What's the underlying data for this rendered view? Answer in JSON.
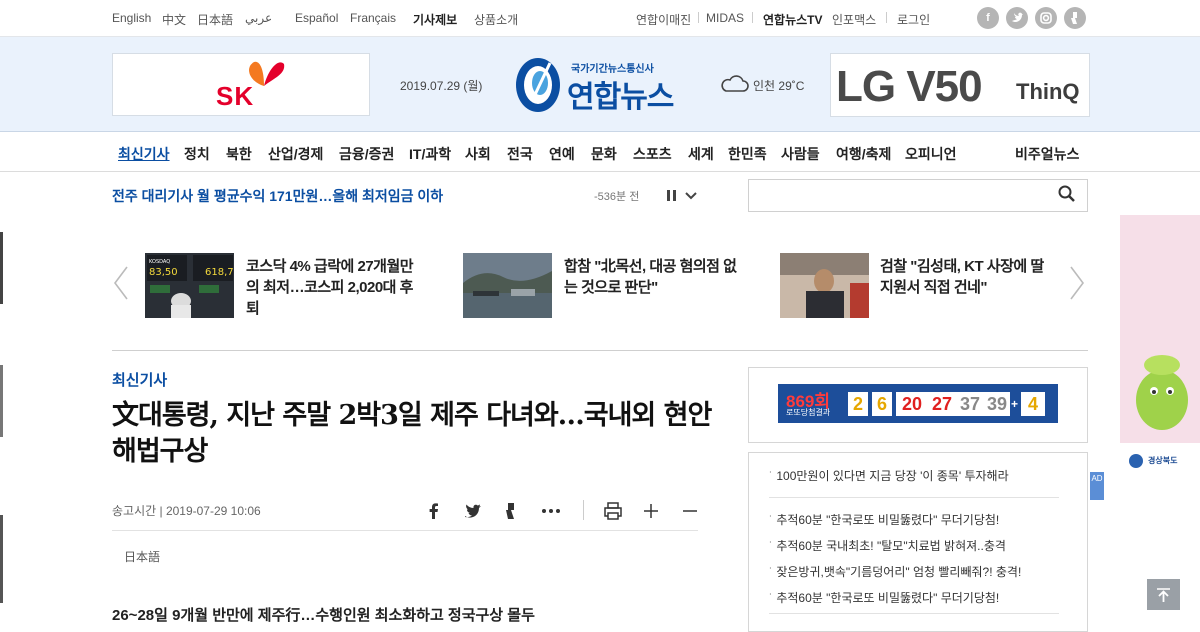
{
  "topbar": {
    "languages": [
      "English",
      "中文",
      "日本語",
      "عربي",
      "Español",
      "Français"
    ],
    "report_label": "기사제보",
    "products_label": "상품소개",
    "links": [
      "연합이매진",
      "MIDAS"
    ],
    "tv_label": "연합뉴스TV",
    "infomax_label": "인포맥스",
    "login_label": "로그인"
  },
  "header": {
    "ad_left_text": "SK",
    "date": "2019.07.29 (월)",
    "logo_sub": "국가기간뉴스통신사",
    "logo_main": "연합뉴스",
    "weather": "인천 29˚C",
    "ad_right_brand": "LG V50",
    "ad_right_sub": "ThinQ"
  },
  "nav": {
    "items": [
      "최신기사",
      "정치",
      "북한",
      "산업/경제",
      "금융/증권",
      "IT/과학",
      "사회",
      "전국",
      "연예",
      "문화",
      "스포츠",
      "세계",
      "한민족",
      "사람들",
      "여행/축제",
      "오피니언"
    ],
    "visual_news_label": "비주얼뉴스"
  },
  "ticker": {
    "headline": "전주 대리기사 월 평균수익 171만원…올해 최저임금 이하",
    "time": "-536분 전"
  },
  "search": {
    "placeholder": ""
  },
  "news_strip": [
    {
      "title": "코스닥 4% 급락에 27개월만의 최저…코스피 2,020대 후퇴",
      "thumb_text": "KOSDAQ"
    },
    {
      "title": "합참 \"北목선, 대공 혐의점 없는 것으로 판단\"",
      "thumb_text": ""
    },
    {
      "title": "검찰 \"김성태, KT 사장에 딸 지원서 직접 건네\"",
      "thumb_text": ""
    }
  ],
  "article": {
    "category": "최신기사",
    "headline": "文대통령, 지난 주말 2박3일 제주 다녀와…국내외 현안 해법구상",
    "send_time": "송고시간 | 2019-07-29 10:06",
    "japanese_label": "日本語",
    "subheadline": "26~28일 9개월 반만에 제주行…수행인원 최소화하고 정국구상 몰두"
  },
  "lotto": {
    "round": "869회",
    "sub": "로또당첨결과",
    "numbers": [
      "2",
      "6",
      "20",
      "27",
      "37",
      "39"
    ],
    "plus": "+",
    "bonus": "4"
  },
  "ad_links": [
    "100만원이 있다면 지금 당장 '이 종목' 투자해라",
    "추적60분 \"한국로또 비밀뚫렸다\" 무더기당첨!",
    "추적60분 국내최초! \"탈모\"치료법 밝혀져..충격",
    "잦은방귀,뱃속\"기름덩어리\" 엄청 빨리빼줘?! 충격!",
    "추적60분 \"한국로또 비밀뚫렸다\" 무더기당첨!"
  ],
  "side_ad": {
    "label": "AD",
    "brand": "경상북도"
  },
  "colors": {
    "brand_blue": "#0b4ea2",
    "header_bg": "#eaf2fc",
    "lotto_bg": "#1d4e9a"
  }
}
